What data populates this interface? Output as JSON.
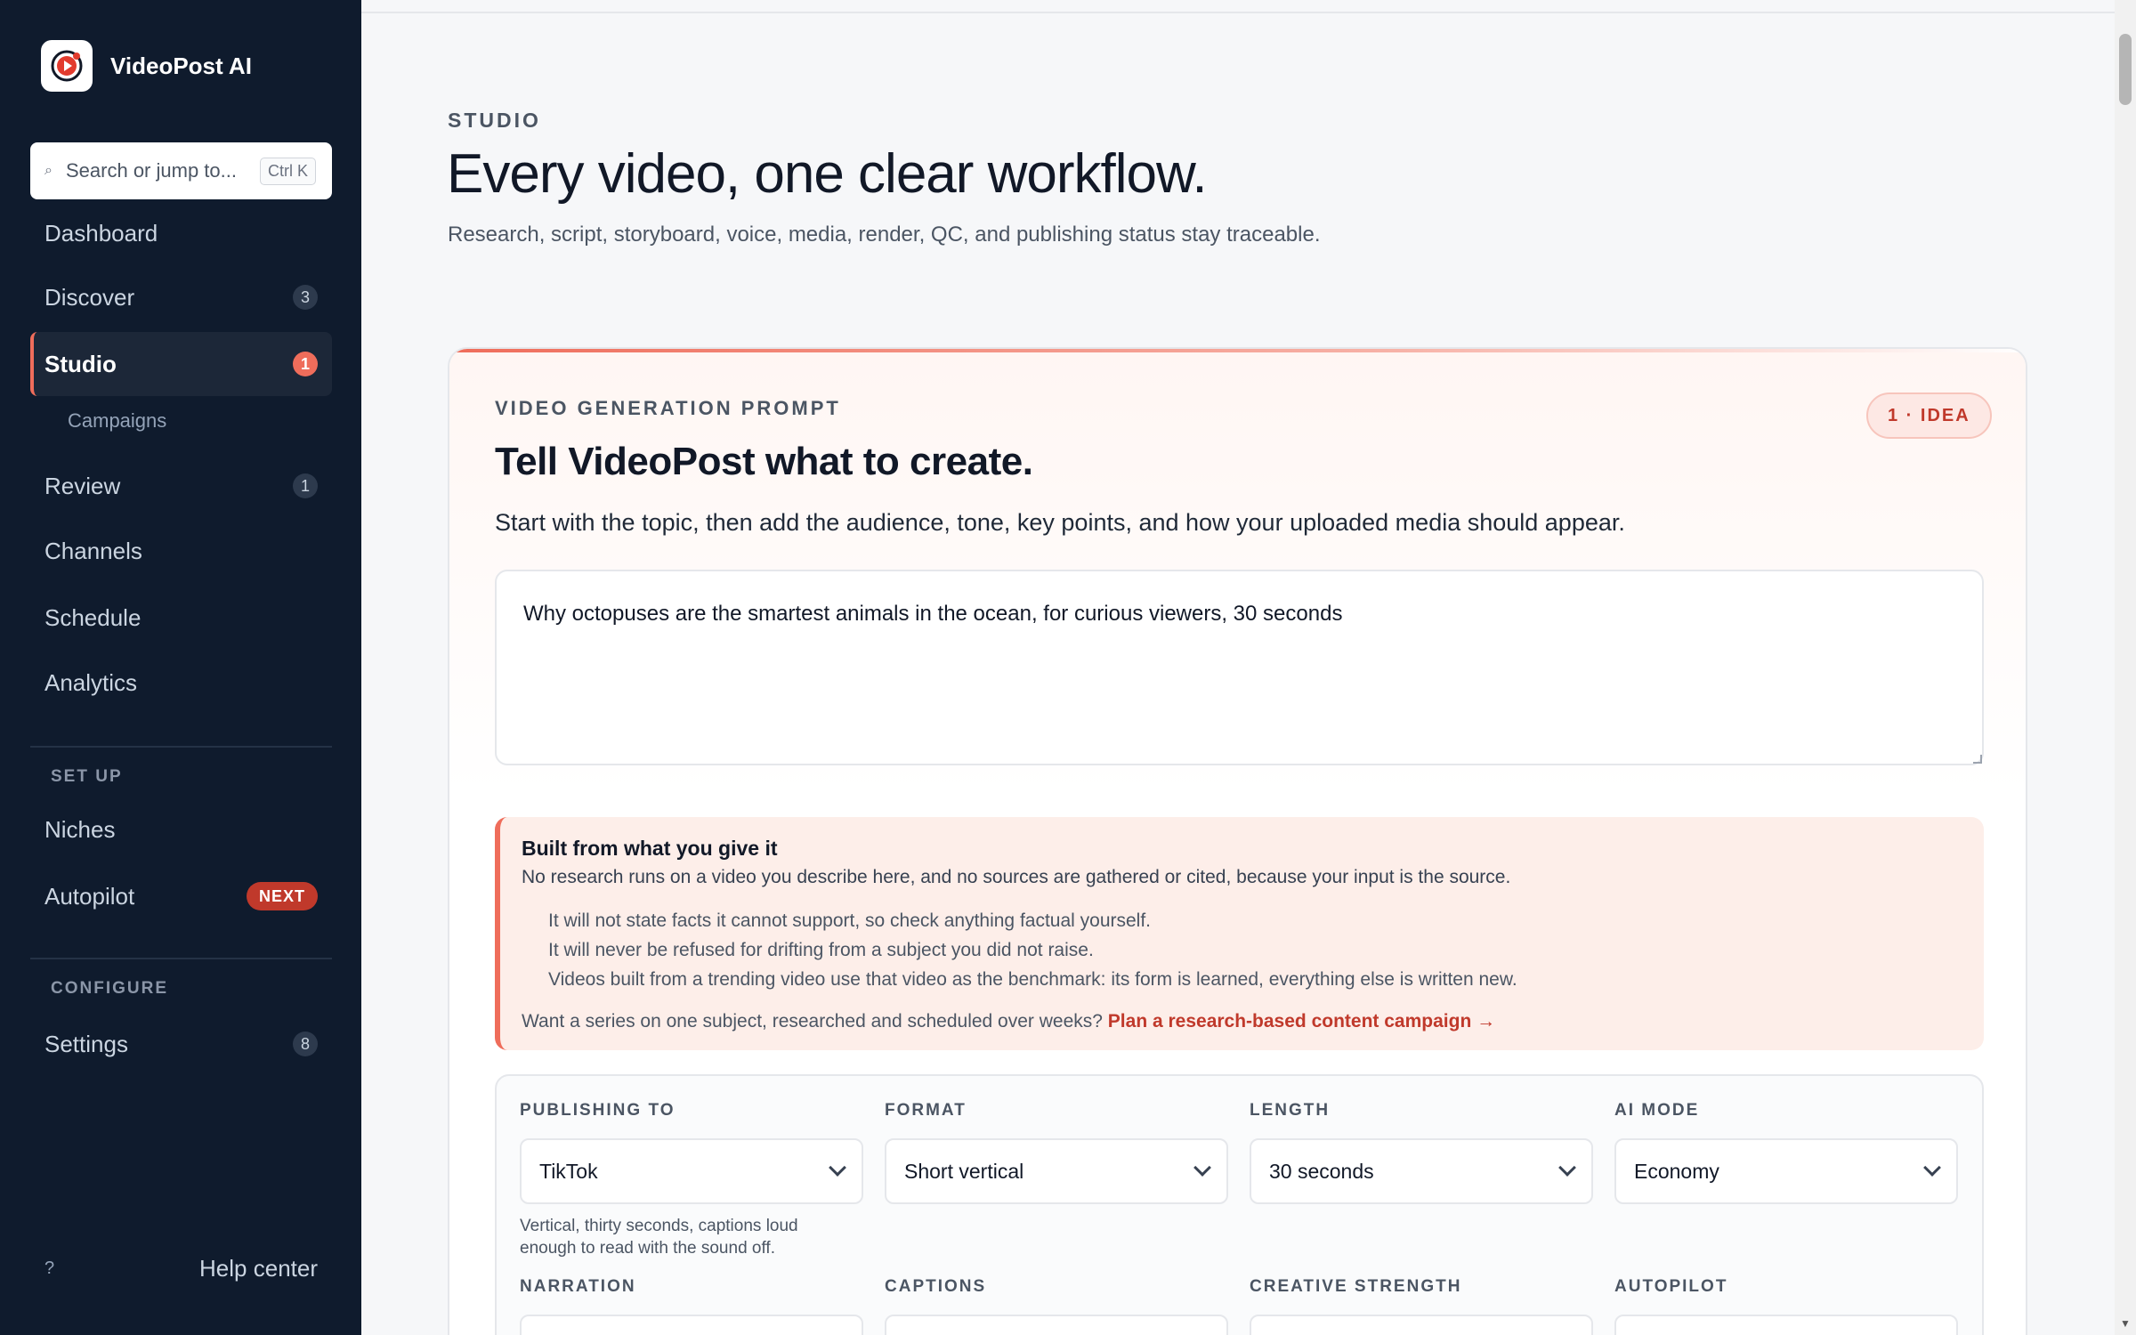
{
  "brand": {
    "name": "VideoPost AI",
    "accent": "#ef6d5b",
    "sidebar_bg": "#0f1b2d"
  },
  "search": {
    "placeholder": "Search or jump to...",
    "shortcut": "Ctrl K"
  },
  "nav": {
    "dashboard": {
      "label": "Dashboard"
    },
    "discover": {
      "label": "Discover",
      "badge": "3"
    },
    "studio": {
      "label": "Studio",
      "badge": "1"
    },
    "campaigns": {
      "label": "Campaigns"
    },
    "review": {
      "label": "Review",
      "badge": "1"
    },
    "channels": {
      "label": "Channels"
    },
    "schedule": {
      "label": "Schedule"
    },
    "analytics": {
      "label": "Analytics"
    },
    "setup_label": "SET UP",
    "niches": {
      "label": "Niches"
    },
    "autopilot": {
      "label": "Autopilot",
      "badge": "NEXT"
    },
    "configure_label": "CONFIGURE",
    "settings": {
      "label": "Settings",
      "badge": "8"
    },
    "help": {
      "icon": "?",
      "label": "Help center"
    }
  },
  "header": {
    "eyebrow": "STUDIO",
    "title": "Every video, one clear workflow.",
    "subtitle": "Research, script, storyboard, voice, media, render, QC, and publishing status stay traceable."
  },
  "card": {
    "eyebrow": "VIDEO GENERATION PROMPT",
    "step": "1 · IDEA",
    "title": "Tell VideoPost what to create.",
    "description": "Start with the topic, then add the audience, tone, key points, and how your uploaded media should appear.",
    "prompt_value": "Why octopuses are the smartest animals in the ocean, for curious viewers, 30 seconds"
  },
  "notice": {
    "title": "Built from what you give it",
    "lead": "No research runs on a video you describe here, and no sources are gathered or cited, because your input is the source.",
    "points": [
      "It will not state facts it cannot support, so check anything factual yourself.",
      "It will never be refused for drifting from a subject you did not raise.",
      "Videos built from a trending video use that video as the benchmark: its form is learned, everything else is written new."
    ],
    "foot": "Want a series on one subject, researched and scheduled over weeks?",
    "link": "Plan a research-based content campaign →"
  },
  "settings": {
    "publishing": {
      "label": "PUBLISHING TO",
      "value": "TikTok",
      "help": "Vertical, thirty seconds, captions loud enough to read with the sound off."
    },
    "format": {
      "label": "FORMAT",
      "value": "Short vertical"
    },
    "length": {
      "label": "LENGTH",
      "value": "30 seconds"
    },
    "ai_mode": {
      "label": "AI MODE",
      "value": "Economy"
    },
    "narration": {
      "label": "NARRATION"
    },
    "captions": {
      "label": "CAPTIONS"
    },
    "creative_strength": {
      "label": "CREATIVE STRENGTH"
    },
    "autopilot": {
      "label": "AUTOPILOT"
    }
  }
}
